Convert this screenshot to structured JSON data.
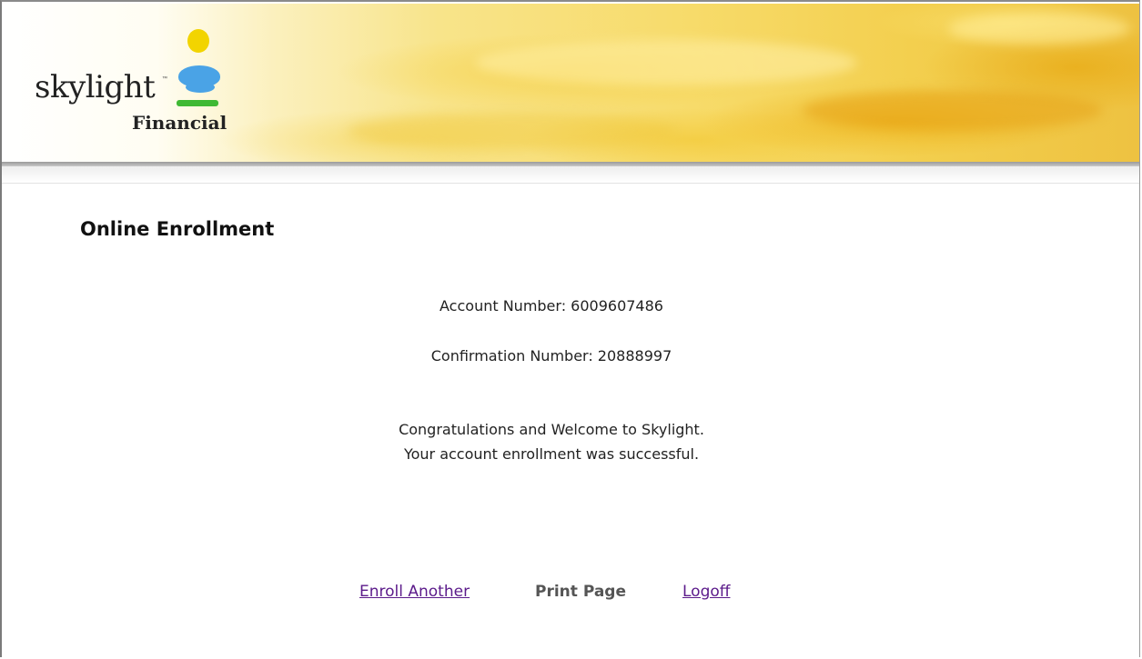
{
  "brand": {
    "logo_word": "skylight",
    "logo_tm": "™",
    "logo_sub": "Financial"
  },
  "page": {
    "heading": "Online Enrollment"
  },
  "confirmation": {
    "account_label": "Account Number: 6009607486",
    "confirmation_label": "Confirmation Number: 20888997",
    "message_line1": "Congratulations and Welcome to Skylight.",
    "message_line2": "Your account enrollment was successful."
  },
  "actions": {
    "enroll_another": "Enroll Another",
    "print_page": "Print Page",
    "logoff": "Logoff"
  },
  "colors": {
    "link": "#5b1a8a",
    "banner_accent": "#f3cf4e",
    "sun": "#f2d400",
    "cloud": "#4aa3e6",
    "grass": "#3fb934"
  }
}
